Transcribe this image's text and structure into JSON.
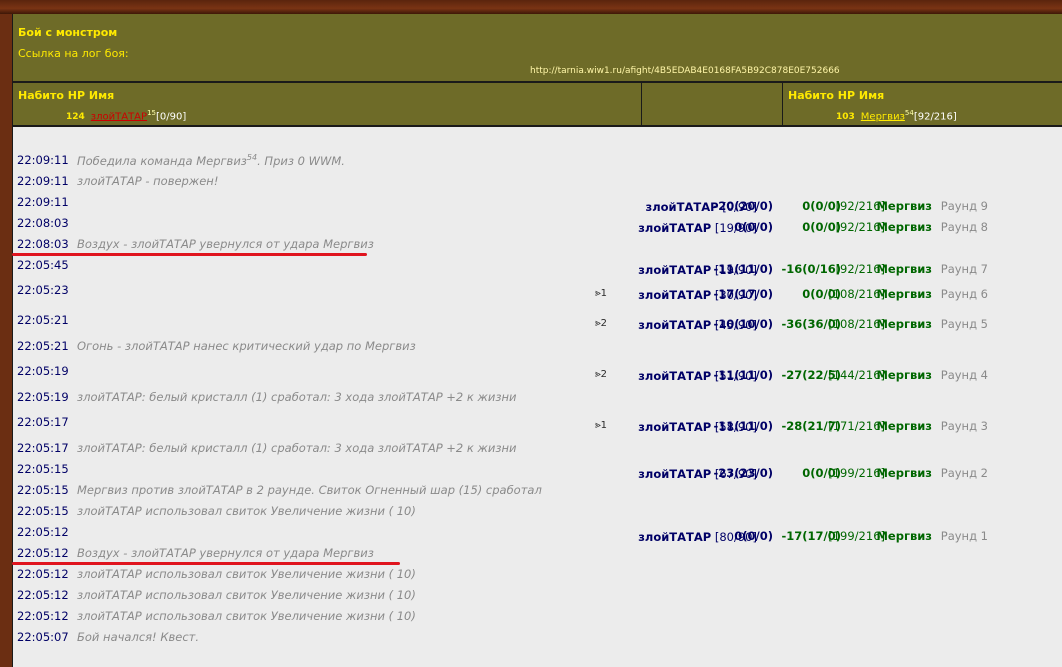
{
  "header": {
    "title": "Бой с монстром",
    "log_label": "Ссылка на лог боя:",
    "log_url": "http://tarnia.wiw1.ru/afight/4B5EDAB4E0168FA5B92C878E0E752666"
  },
  "teams": {
    "left_header": "Набито HP Имя",
    "left_hp": "124",
    "left_name": "злойТАТАР",
    "left_level": "15",
    "left_status": "[0/90]",
    "right_header": "Набито HP Имя",
    "right_hp": "103",
    "right_name": "Мергвиз",
    "right_level": "54",
    "right_status": "[92/216]"
  },
  "log": [
    {
      "time": "22:09:11",
      "type": "msg",
      "text": "Победила команда Мергвиз",
      "sup": "54",
      "text2": ". Приз 0 WWM."
    },
    {
      "time": "22:09:11",
      "type": "msg",
      "text": "злойТАТАР - повержен!"
    },
    {
      "time": "22:09:11",
      "type": "atk",
      "icon": "",
      "name": "злойТАТАР",
      "hp": "[0/90]",
      "dmg1": "-20(20/0)",
      "dmg2": "0(0/0)",
      "ehp": "[92/216]",
      "ename": "Мергвиз",
      "round": "Раунд 9"
    },
    {
      "time": "22:08:03",
      "type": "atk",
      "icon": "",
      "name": "злойТАТАР",
      "hp": "[19/90]",
      "dmg1": "0(0/0)",
      "dmg2": "0(0/0)",
      "ehp": "[92/216]",
      "ename": "Мергвиз",
      "round": "Раунд 8"
    },
    {
      "time": "22:08:03",
      "type": "msg",
      "text": "Воздух - злойТАТАР увернулся от удара Мергвиз",
      "underline": true
    },
    {
      "time": "22:05:45",
      "type": "atk",
      "icon": "",
      "name": "злойТАТАР",
      "hp": "[19/90]",
      "dmg1": "-11(11/0)",
      "dmg2": "-16(0/16)",
      "ehp": "[92/216]",
      "ename": "Мергвиз",
      "round": "Раунд 7"
    },
    {
      "time": "22:05:23",
      "type": "atk",
      "icon": "⪢1",
      "name": "злойТАТАР",
      "hp": "[30/90]",
      "dmg1": "-17(17/0)",
      "dmg2": "0(0/0)",
      "ehp": "[108/216]",
      "ename": "Мергвиз",
      "round": "Раунд 6"
    },
    {
      "time": "22:05:21",
      "type": "atk",
      "icon": "⪢2",
      "name": "злойТАТАР",
      "hp": "[45/90]",
      "dmg1": "-10(10/0)",
      "dmg2": "-36(36/0)",
      "ehp": "[108/216]",
      "ename": "Мергвиз",
      "round": "Раунд 5"
    },
    {
      "time": "22:05:21",
      "type": "msg",
      "text": "Огонь - злойТАТАР нанес критический удар по Мергвиз"
    },
    {
      "time": "22:05:19",
      "type": "atk",
      "icon": "⪢2",
      "name": "злойТАТАР",
      "hp": "[51/90]",
      "dmg1": "-11(11/0)",
      "dmg2": "-27(22/5)",
      "ehp": "[144/216]",
      "ename": "Мергвиз",
      "round": "Раунд 4"
    },
    {
      "time": "22:05:19",
      "type": "msg",
      "text": "злойТАТАР: белый кристалл (1) сработал: 3 хода злойТАТАР +2 к жизни"
    },
    {
      "time": "22:05:17",
      "type": "atk",
      "icon": "⪢1",
      "name": "злойТАТАР",
      "hp": "[58/90]",
      "dmg1": "-11(11/0)",
      "dmg2": "-28(21/7)",
      "ehp": "[171/216]",
      "ename": "Мергвиз",
      "round": "Раунд 3"
    },
    {
      "time": "22:05:17",
      "type": "msg",
      "text": "злойТАТАР: белый кристалл (1) сработал: 3 хода злойТАТАР +2 к жизни"
    },
    {
      "time": "22:05:15",
      "type": "atk",
      "icon": "",
      "name": "злойТАТАР",
      "hp": "[67/90]",
      "dmg1": "-23(23/0)",
      "dmg2": "0(0/0)",
      "ehp": "[199/216]",
      "ename": "Мергвиз",
      "round": "Раунд 2"
    },
    {
      "time": "22:05:15",
      "type": "msg",
      "text": "Мергвиз против злойТАТАР в 2 раунде. Свиток Огненный шар (15) сработал"
    },
    {
      "time": "22:05:15",
      "type": "msg",
      "text": "злойТАТАР использовал свиток Увеличение жизни ( 10)"
    },
    {
      "time": "22:05:12",
      "type": "atk",
      "icon": "",
      "name": "злойТАТАР",
      "hp": "[80/90]",
      "dmg1": "0(0/0)",
      "dmg2": "-17(17/0)",
      "ehp": "[199/216]",
      "ename": "Мергвиз",
      "round": "Раунд 1"
    },
    {
      "time": "22:05:12",
      "type": "msg",
      "text": "Воздух - злойТАТАР увернулся от удара Мергвиз",
      "underline": true
    },
    {
      "time": "22:05:12",
      "type": "msg",
      "text": "злойТАТАР использовал свиток Увеличение жизни ( 10)"
    },
    {
      "time": "22:05:12",
      "type": "msg",
      "text": "злойТАТАР использовал свиток Увеличение жизни ( 10)"
    },
    {
      "time": "22:05:12",
      "type": "msg",
      "text": "злойТАТАР использовал свиток Увеличение жизни ( 10)"
    },
    {
      "time": "22:05:07",
      "type": "msg",
      "text": "Бой начался! Квест."
    }
  ]
}
